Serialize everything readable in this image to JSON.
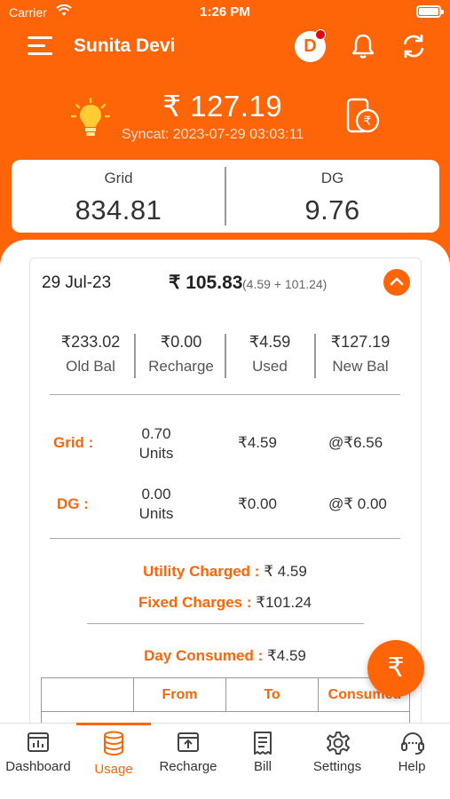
{
  "status_bar": {
    "carrier": "Carrier",
    "time": "1:26 PM"
  },
  "header": {
    "user_name": "Sunita Devi",
    "avatar_initial": "D",
    "balance": "₹ 127.19",
    "syncat": "Syncat: 2023-07-29 03:03:11"
  },
  "meters": [
    {
      "label": "Grid",
      "value": "834.81"
    },
    {
      "label": "DG",
      "value": "9.76"
    }
  ],
  "day": {
    "date": "29  Jul-23",
    "amount": "₹ 105.83",
    "breakdown": "(4.59 + 101.24)",
    "summary": [
      {
        "value": "₹233.02",
        "label": "Old Bal"
      },
      {
        "value": "₹0.00",
        "label": "Recharge"
      },
      {
        "value": "₹4.59",
        "label": "Used"
      },
      {
        "value": "₹127.19",
        "label": "New Bal"
      }
    ],
    "rates": [
      {
        "label": "Grid :",
        "units_value": "0.70",
        "units_label": "Units",
        "amount": "₹4.59",
        "rate": "@₹6.56"
      },
      {
        "label": "DG :",
        "units_value": "0.00",
        "units_label": "Units",
        "amount": "₹0.00",
        "rate": "@₹ 0.00"
      }
    ],
    "utility_label": "Utility Charged :",
    "utility_value": "₹ 4.59",
    "fixed_label": "Fixed Charges :",
    "fixed_value": "₹101.24",
    "consumed_label": "Day Consumed :",
    "consumed_value": "₹4.59",
    "table_headers": [
      "",
      "From",
      "To",
      "Consumed"
    ]
  },
  "fab_symbol": "₹",
  "tabs": [
    {
      "label": "Dashboard",
      "icon": "dashboard-icon"
    },
    {
      "label": "Usage",
      "icon": "database-icon",
      "active": true
    },
    {
      "label": "Recharge",
      "icon": "recharge-icon"
    },
    {
      "label": "Bill",
      "icon": "bill-icon"
    },
    {
      "label": "Settings",
      "icon": "gear-icon"
    },
    {
      "label": "Help",
      "icon": "headset-icon"
    }
  ],
  "colors": {
    "accent": "#fd6508",
    "badge": "#e10010"
  }
}
